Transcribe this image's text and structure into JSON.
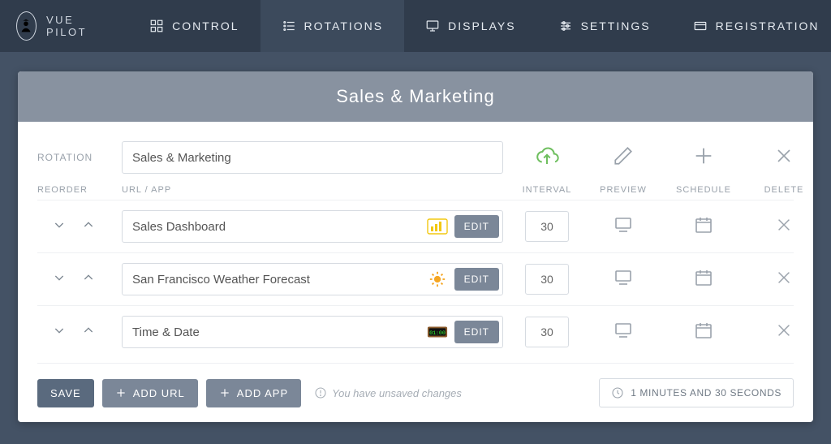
{
  "brand": "VUE PILOT",
  "nav": [
    {
      "label": "CONTROL",
      "icon": "grid"
    },
    {
      "label": "ROTATIONS",
      "icon": "list",
      "active": true
    },
    {
      "label": "DISPLAYS",
      "icon": "monitor"
    },
    {
      "label": "SETTINGS",
      "icon": "sliders"
    },
    {
      "label": "REGISTRATION",
      "icon": "card"
    }
  ],
  "page_title": "Sales & Marketing",
  "rotation_label": "ROTATION",
  "rotation_name": "Sales & Marketing",
  "columns": {
    "reorder": "REORDER",
    "url_app": "URL / APP",
    "interval": "INTERVAL",
    "preview": "PREVIEW",
    "schedule": "SCHEDULE",
    "delete": "DELETE"
  },
  "items": [
    {
      "name": "Sales Dashboard",
      "app_icon": "powerbi",
      "interval": "30",
      "edit": "EDIT"
    },
    {
      "name": "San Francisco Weather Forecast",
      "app_icon": "sun",
      "interval": "30",
      "edit": "EDIT"
    },
    {
      "name": "Time & Date",
      "app_icon": "clock",
      "interval": "30",
      "edit": "EDIT"
    }
  ],
  "footer": {
    "save": "SAVE",
    "add_url": "ADD URL",
    "add_app": "ADD APP",
    "unsaved": "You have unsaved changes",
    "duration": "1 MINUTES AND 30 SECONDS"
  }
}
